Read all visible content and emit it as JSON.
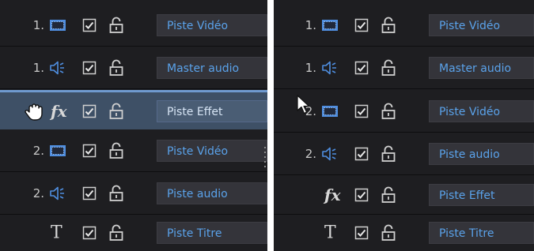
{
  "left_panel": {
    "rows": [
      {
        "number": "1.",
        "type_icon": "video-track-icon",
        "name": "Piste Vidéo"
      },
      {
        "number": "1.",
        "type_icon": "audio-track-icon",
        "name": "Master audio"
      },
      {
        "number": "",
        "type_icon": "effect-track-icon",
        "type_text": "fx",
        "name": "Piste Effet",
        "state": "dragging",
        "cursor_icon": "grab-hand-cursor-icon"
      },
      {
        "number": "2.",
        "type_icon": "video-track-icon",
        "name": "Piste Vidéo"
      },
      {
        "number": "2.",
        "type_icon": "audio-track-icon",
        "name": "Piste audio"
      },
      {
        "number": "",
        "type_icon": "title-track-icon",
        "type_text": "T",
        "name": "Piste Titre"
      }
    ]
  },
  "right_panel": {
    "rows": [
      {
        "number": "1.",
        "type_icon": "video-track-icon",
        "name": "Piste Vidéo"
      },
      {
        "number": "1.",
        "type_icon": "audio-track-icon",
        "name": "Master audio"
      },
      {
        "number": "2.",
        "type_icon": "video-track-icon",
        "name": "Piste Vidéo",
        "cursor_icon": "arrow-cursor-icon"
      },
      {
        "number": "2.",
        "type_icon": "audio-track-icon",
        "name": "Piste audio"
      },
      {
        "number": "",
        "type_icon": "effect-track-icon",
        "type_text": "fx",
        "name": "Piste Effet"
      },
      {
        "number": "",
        "type_icon": "title-track-icon",
        "type_text": "T",
        "name": "Piste Titre"
      }
    ]
  },
  "track_controls": {
    "checkbox_icon": "checkbox-checked-icon",
    "lock_icon": "unlocked-padlock-icon"
  },
  "colors": {
    "panel_bg": "#1e1e21",
    "label_text": "#5aa2ea",
    "label_bg": "#34343a",
    "selected_row": "#3e5066",
    "selected_border": "#6f9ad0",
    "icon_blue": "#4f8ee0"
  }
}
